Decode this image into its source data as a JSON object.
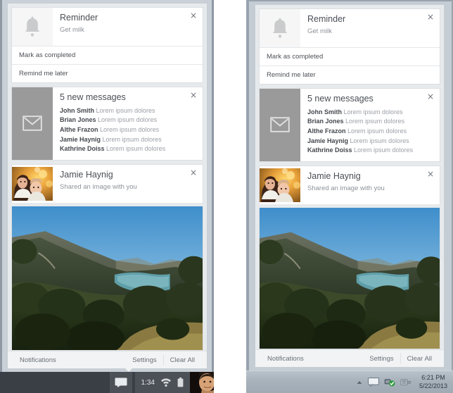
{
  "panels": [
    {
      "id": "panel-a",
      "variant": "dark-taskbar",
      "notifications": [
        {
          "type": "reminder",
          "icon": "bell-icon",
          "title": "Reminder",
          "subtitle": "Get milk",
          "close_label": "×",
          "actions": [
            "Mark as completed",
            "Remind me later"
          ]
        },
        {
          "type": "messages",
          "icon": "mail-icon",
          "title": "5 new messages",
          "close_label": "×",
          "messages": [
            {
              "sender": "John Smith",
              "preview": "Lorem ipsum dolores"
            },
            {
              "sender": "Brian Jones",
              "preview": "Lorem ipsum dolores"
            },
            {
              "sender": "Althe Frazon",
              "preview": "Lorem ipsum dolores"
            },
            {
              "sender": "Jamie Haynig",
              "preview": "Lorem ipsum dolores"
            },
            {
              "sender": "Kathrine Doiss",
              "preview": "Lorem ipsum dolores"
            }
          ]
        },
        {
          "type": "shared-image",
          "icon": "contact-photo",
          "title": "Jamie Haynig",
          "subtitle": "Shared an image with you",
          "close_label": "×",
          "attachment": "landscape-lake-photo"
        }
      ],
      "footer": {
        "label": "Notifications",
        "settings_label": "Settings",
        "clear_all_label": "Clear All"
      },
      "taskbar": {
        "notification_icon": "speech-bubble-icon",
        "clock": "1:34",
        "tray_icons": [
          "wifi-icon",
          "battery-icon"
        ],
        "avatar": "user-avatar"
      }
    },
    {
      "id": "panel-b",
      "variant": "light-taskbar",
      "notifications": [
        {
          "type": "reminder",
          "icon": "bell-icon",
          "title": "Reminder",
          "subtitle": "Get milk",
          "close_label": "×",
          "actions": [
            "Mark as completed",
            "Remind me later"
          ]
        },
        {
          "type": "messages",
          "icon": "mail-icon",
          "title": "5 new messages",
          "close_label": "×",
          "messages": [
            {
              "sender": "John Smith",
              "preview": "Lorem ipsum dolores"
            },
            {
              "sender": "Brian Jones",
              "preview": "Lorem ipsum dolores"
            },
            {
              "sender": "Althe Frazon",
              "preview": "Lorem ipsum dolores"
            },
            {
              "sender": "Jamie Haynig",
              "preview": "Lorem ipsum dolores"
            },
            {
              "sender": "Kathrine Doiss",
              "preview": "Lorem ipsum dolores"
            }
          ]
        },
        {
          "type": "shared-image",
          "icon": "contact-photo",
          "title": "Jamie Haynig",
          "subtitle": "Shared an image with you",
          "close_label": "×",
          "attachment": "landscape-lake-photo"
        }
      ],
      "footer": {
        "label": "Notifications",
        "settings_label": "Settings",
        "clear_all_label": "Clear All"
      },
      "taskbar": {
        "show_hidden_icon": "chevron-up-icon",
        "tray_icons": [
          "speech-bubble-icon",
          "network-shield-icon",
          "flash-drive-icon"
        ],
        "clock_time": "6:21 PM",
        "clock_date": "5/22/2013"
      }
    }
  ],
  "colors": {
    "desktop_a": "#8e99a4",
    "desktop_a_inner": "#c9d0d7",
    "desktop_b": "#98a3ae",
    "desktop_b_inner": "#c4ccd4",
    "flyout_bg": "#ffffff",
    "card_bg": "#ffffff",
    "stack_bg": "#e7eaec",
    "taskbar_dark": "#3a3f45",
    "taskbar_light": "#a7b2bb",
    "mail_thumb": "#9a9a9a",
    "bell_thumb": "#f6f6f6",
    "text_primary": "#4a4f55",
    "text_secondary": "#8d9298"
  }
}
